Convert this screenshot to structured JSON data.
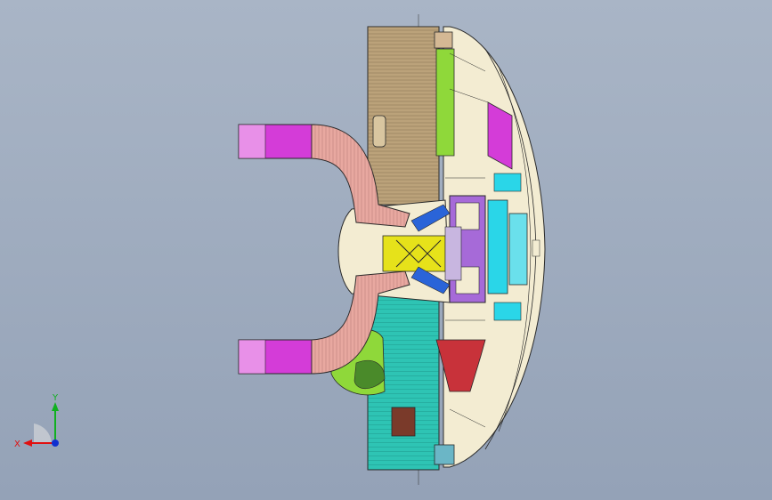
{
  "triad": {
    "x_label": "X",
    "y_label": "Y",
    "colors": {
      "x": "#e01010",
      "y": "#10b020",
      "z": "#1030d0"
    }
  },
  "palette": {
    "tan": "#bba27a",
    "teal": "#2ec4b4",
    "magenta": "#d43cd8",
    "salmon": "#e8a8a0",
    "cream": "#f3ecd2",
    "yellow": "#e6e21a",
    "purple": "#a66ad8",
    "green": "#8fd83a",
    "red": "#c8323a",
    "blue": "#2a64d8",
    "cyan": "#2ad6e8"
  }
}
